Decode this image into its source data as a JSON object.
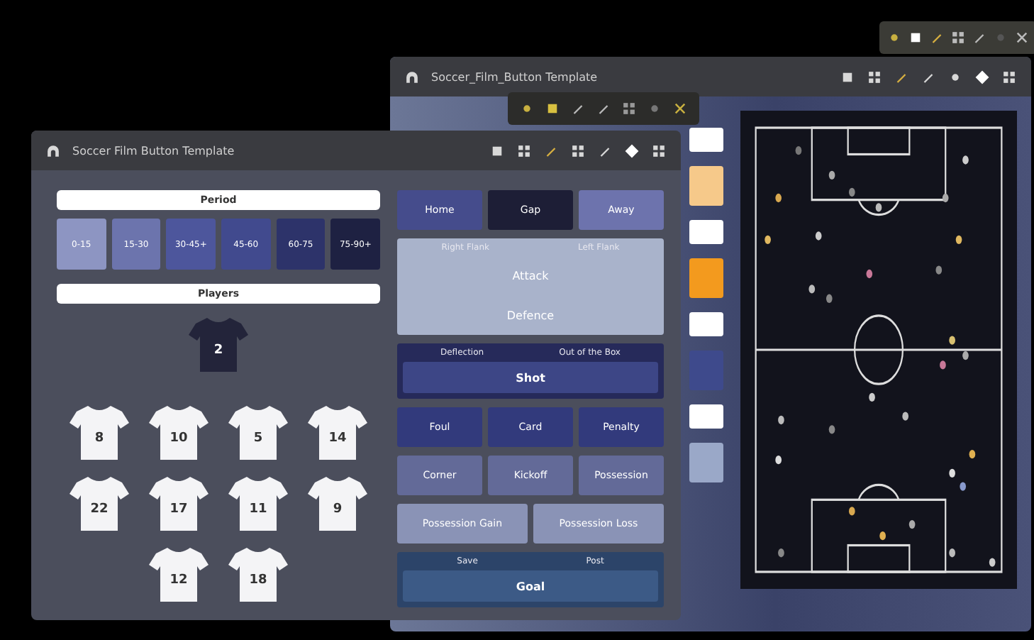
{
  "back_window": {
    "title": "Soccer_Film_Button Template",
    "swatches": [
      {
        "kind": "bar",
        "color": "#ffffff"
      },
      {
        "kind": "block",
        "color": "#f6c98a"
      },
      {
        "kind": "bar",
        "color": "#ffffff"
      },
      {
        "kind": "block",
        "color": "#f39a1e"
      },
      {
        "kind": "bar",
        "color": "#ffffff"
      },
      {
        "kind": "block",
        "color": "#3e4a8c"
      },
      {
        "kind": "bar",
        "color": "#ffffff"
      },
      {
        "kind": "block",
        "color": "#9aa8c8"
      }
    ]
  },
  "front_window": {
    "title": "Soccer Film Button Template",
    "period_header": "Period",
    "periods": [
      {
        "label": "0-15",
        "color": "#8d95c2"
      },
      {
        "label": "15-30",
        "color": "#6c74ad"
      },
      {
        "label": "30-45+",
        "color": "#4d569c"
      },
      {
        "label": "45-60",
        "color": "#414a8e"
      },
      {
        "label": "60-75",
        "color": "#2d336a"
      },
      {
        "label": "75-90+",
        "color": "#1e2142"
      }
    ],
    "players_header": "Players",
    "players": [
      {
        "number": "2",
        "selected": true
      },
      {
        "number": "8",
        "selected": false
      },
      {
        "number": "10",
        "selected": false
      },
      {
        "number": "5",
        "selected": false
      },
      {
        "number": "14",
        "selected": false
      },
      {
        "number": "22",
        "selected": false
      },
      {
        "number": "17",
        "selected": false
      },
      {
        "number": "11",
        "selected": false
      },
      {
        "number": "9",
        "selected": false
      },
      {
        "number": "12",
        "selected": false
      },
      {
        "number": "18",
        "selected": false
      }
    ],
    "team_buttons": [
      {
        "label": "Home",
        "color": "#454c8c"
      },
      {
        "label": "Gap",
        "color": "#1d1e36"
      },
      {
        "label": "Away",
        "color": "#6d73ad"
      }
    ],
    "attack_zone": {
      "labels": [
        "Right Flank",
        "Left Flank"
      ],
      "buttons": [
        "Attack",
        "Defence"
      ]
    },
    "shot_zone": {
      "labels": [
        "Deflection",
        "Out of the Box"
      ],
      "button": "Shot"
    },
    "event_rows": [
      {
        "color": "#323a7c",
        "buttons": [
          "Foul",
          "Card",
          "Penalty"
        ]
      },
      {
        "color": "#636a98",
        "buttons": [
          "Corner",
          "Kickoff",
          "Possession"
        ]
      },
      {
        "color": "#8a93b6",
        "buttons": [
          "Possession Gain",
          "Possession Loss"
        ]
      }
    ],
    "goal_zone": {
      "labels": [
        "Save",
        "Post"
      ],
      "button": "Goal"
    }
  }
}
